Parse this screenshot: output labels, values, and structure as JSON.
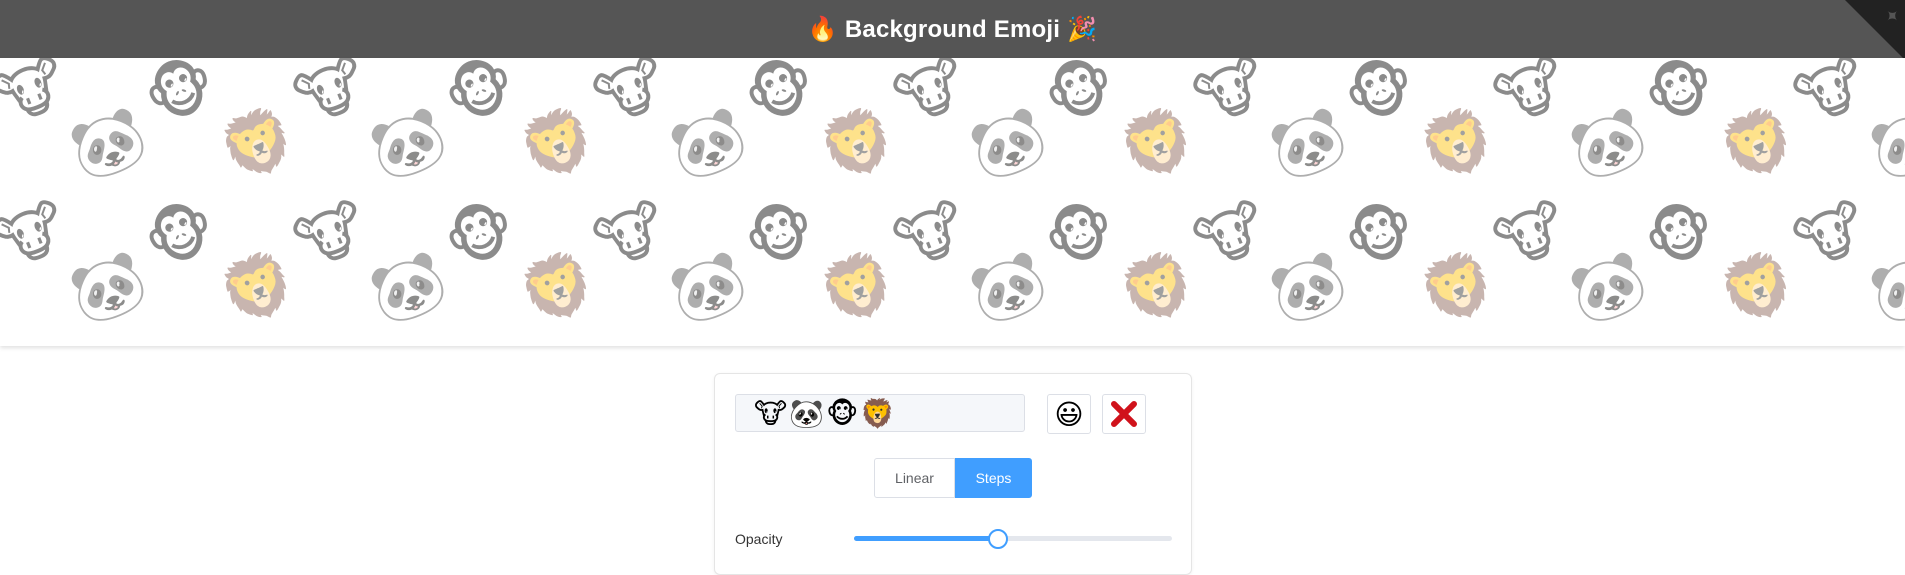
{
  "header": {
    "title": "🔥 Background Emoji 🎉",
    "corner_icon": "github-corner-icon"
  },
  "background": {
    "emojis": [
      "🐮",
      "🐼",
      "🐵",
      "🦁"
    ]
  },
  "controls": {
    "emoji_input_value": "🐮🐼🐵🦁",
    "emoji_picker_button": "😃",
    "clear_button_icon": "cross-mark-icon",
    "modes": [
      {
        "label": "Linear",
        "active": false
      },
      {
        "label": "Steps",
        "active": true
      }
    ],
    "opacity_label": "Opacity",
    "opacity_value": 0.45
  },
  "colors": {
    "header_bg": "#555555",
    "accent": "#409eff",
    "clear_red": "#d0121b"
  }
}
